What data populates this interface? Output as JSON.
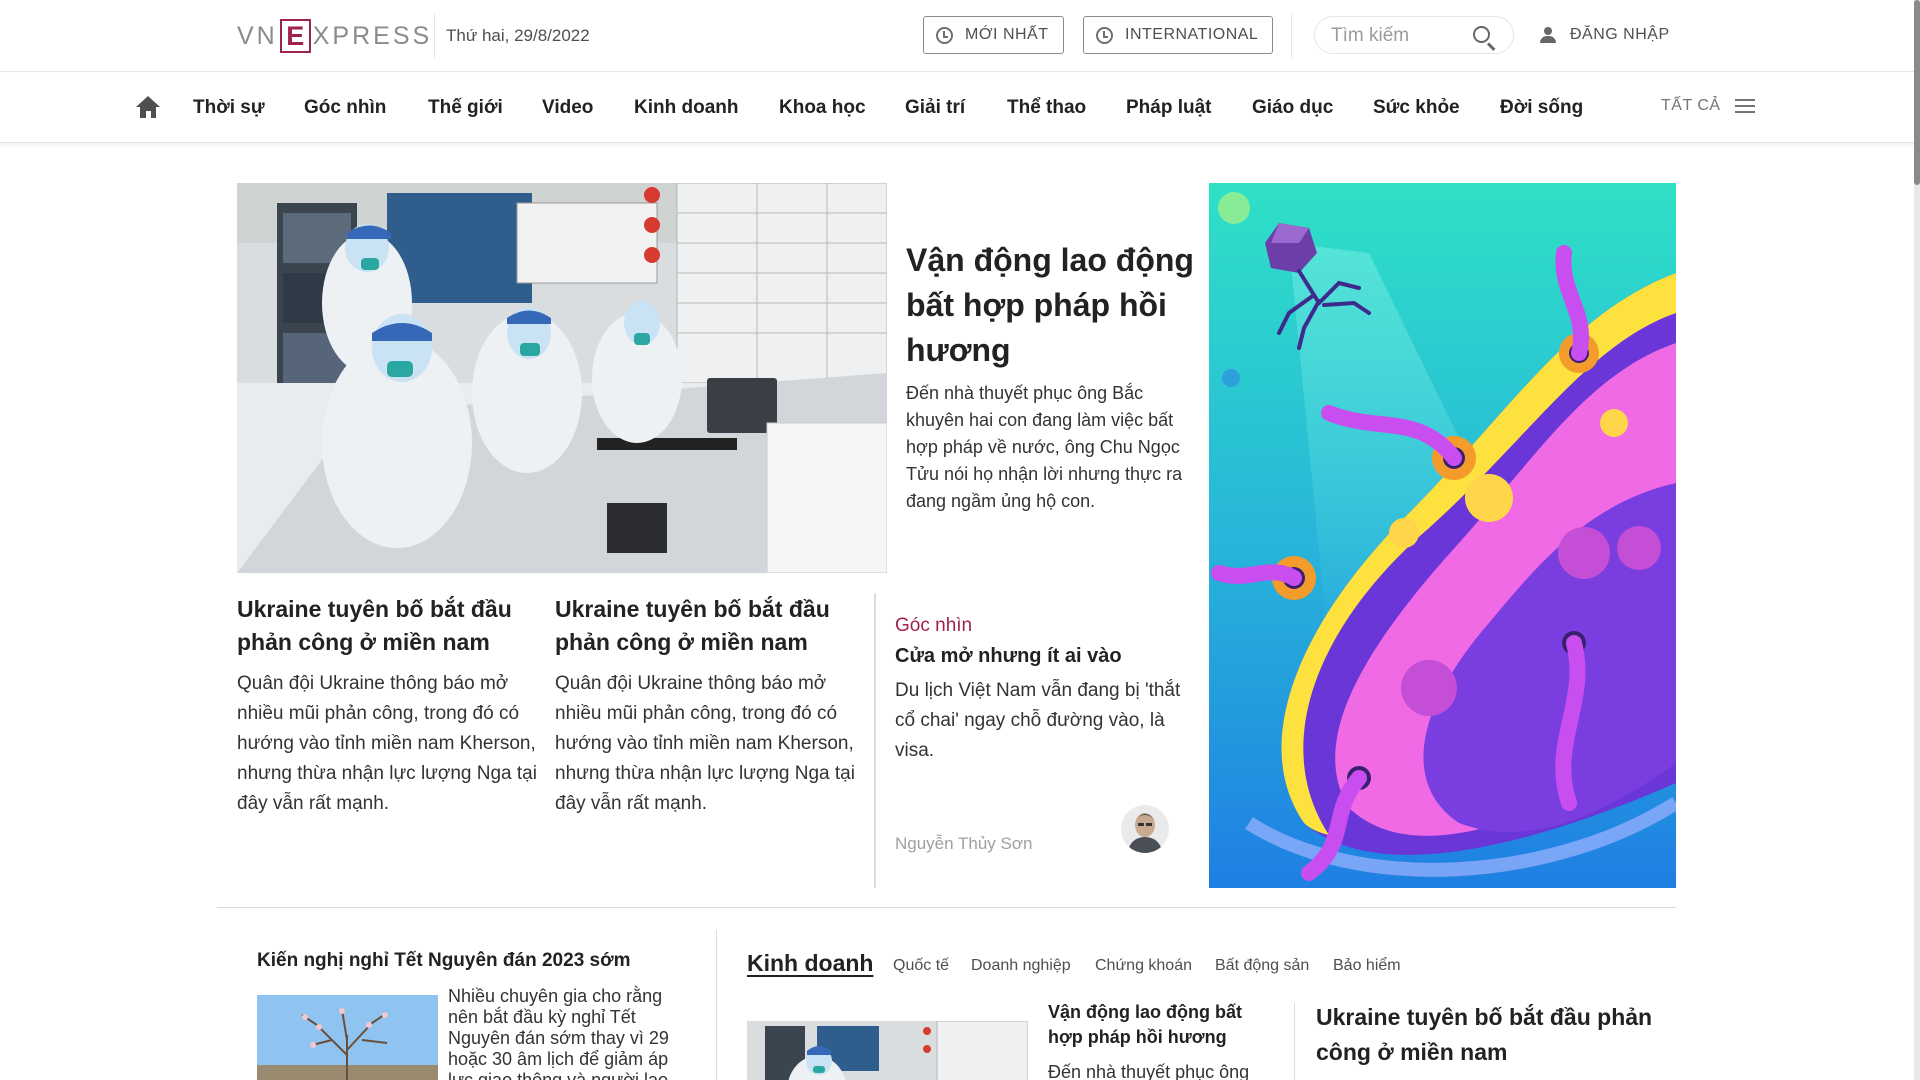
{
  "header": {
    "logo_left": "VN",
    "logo_mark": "E",
    "logo_right": "XPRESS",
    "date": "Thứ hai, 29/8/2022",
    "latest_button": "MỚI NHẤT",
    "international_button": "INTERNATIONAL",
    "search_placeholder": "Tìm kiếm",
    "login_label": "ĐĂNG NHẬP"
  },
  "nav": {
    "items": [
      "Thời sự",
      "Góc nhìn",
      "Thế giới",
      "Video",
      "Kinh doanh",
      "Khoa học",
      "Giải trí",
      "Thể thao",
      "Pháp luật",
      "Giáo dục",
      "Sức khỏe",
      "Đời sống"
    ],
    "all_label": "TẤT CẢ"
  },
  "hero": {
    "title": "Vận động lao động bất hợp pháp hồi hương",
    "description": "Đến nhà thuyết phục ông Bắc khuyên hai con đang làm việc bất hợp pháp về nước, ông Chu Ngọc Tửu nói họ nhận lời nhưng thực ra đang ngầm ủng hộ con."
  },
  "sub_news": [
    {
      "title": "Ukraine tuyên bố bắt đầu phản công ở miền nam",
      "description": "Quân đội Ukraine thông báo mở nhiều mũi phản công, trong đó có hướng vào tỉnh miền nam Kherson, nhưng thừa nhận lực lượng Nga tại đây vẫn rất mạnh."
    },
    {
      "title": "Ukraine tuyên bố bắt đầu phản công ở miền nam",
      "description": "Quân đội Ukraine thông báo mở nhiều mũi phản công, trong đó có hướng vào tỉnh miền nam Kherson, nhưng thừa nhận lực lượng Nga tại đây vẫn rất mạnh."
    }
  ],
  "opinion": {
    "category": "Góc nhìn",
    "title": "Cửa mở nhưng ít ai vào",
    "description": "Du lịch Việt Nam vẫn đang bị 'thắt cổ chai' ngay chỗ đường vào, là visa.",
    "author": "Nguyễn Thủy Sơn"
  },
  "lower_left": {
    "title": "Kiến nghị nghỉ Tết Nguyên đán 2023 sớm",
    "description": "Nhiều chuyên gia cho rằng nên bắt đầu kỳ nghỉ Tết Nguyên đán sớm thay vì 29 hoặc 30 âm lịch để giảm áp lực giao thông và người lao"
  },
  "business": {
    "section_title": "Kinh doanh",
    "subcategories": [
      "Quốc tế",
      "Doanh nghiệp",
      "Chứng khoán",
      "Bất động sản",
      "Bảo hiểm"
    ],
    "article_title": "Vận động lao động bất hợp pháp hồi hương",
    "article_description": "Đến nhà thuyết phục ông",
    "right_title": "Ukraine tuyên bố bắt đầu phản công ở miền nam"
  },
  "colors": {
    "brand": "#9f224e",
    "text": "#222222",
    "muted": "#8b8b8b"
  }
}
